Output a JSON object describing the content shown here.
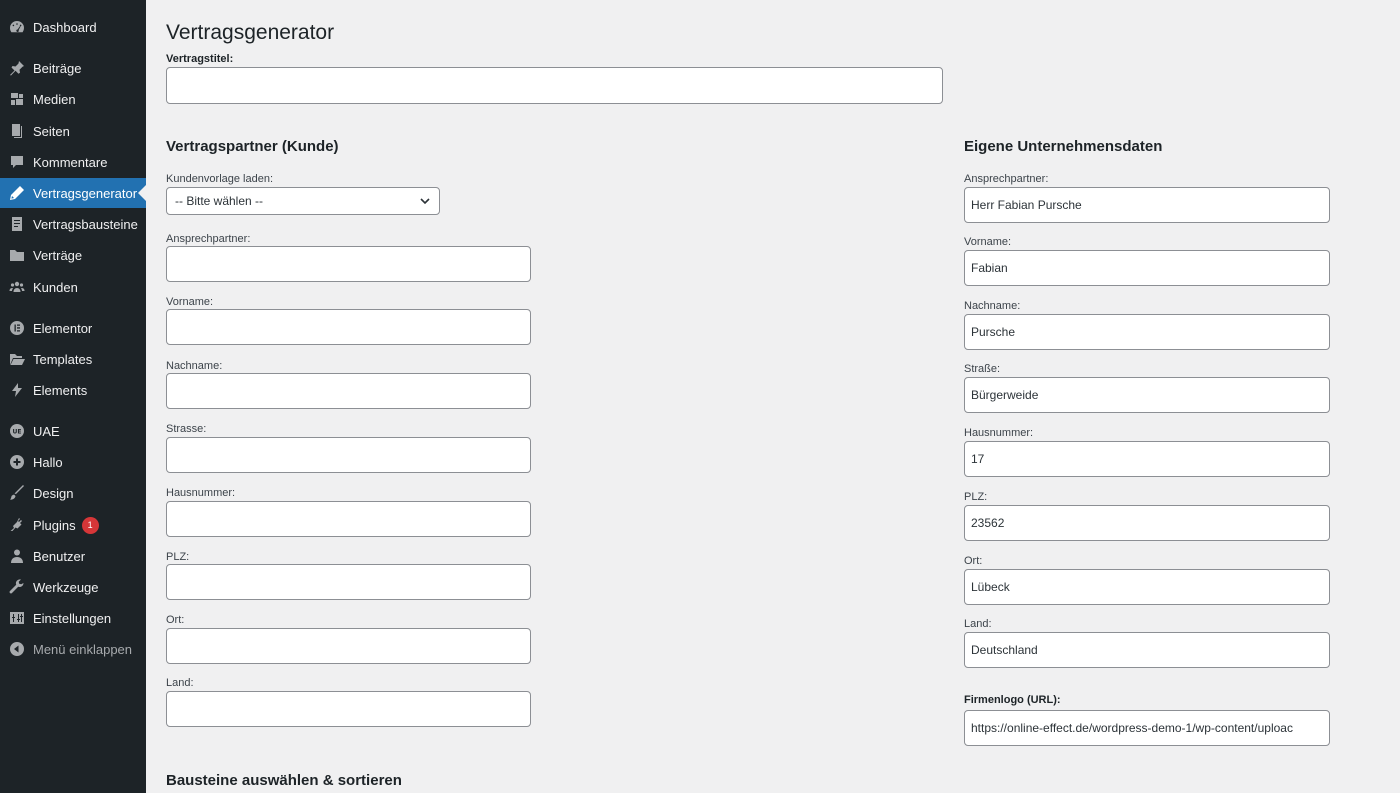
{
  "sidebar": {
    "items": [
      {
        "label": "Dashboard",
        "icon": "dashboard-icon"
      },
      {
        "label": "Beiträge",
        "icon": "pin-icon"
      },
      {
        "label": "Medien",
        "icon": "media-icon"
      },
      {
        "label": "Seiten",
        "icon": "page-icon"
      },
      {
        "label": "Kommentare",
        "icon": "comment-icon"
      },
      {
        "label": "Vertragsgenerator",
        "icon": "pencil-icon"
      },
      {
        "label": "Vertragsbausteine",
        "icon": "document-icon"
      },
      {
        "label": "Verträge",
        "icon": "folder-icon"
      },
      {
        "label": "Kunden",
        "icon": "groups-icon"
      },
      {
        "label": "Elementor",
        "icon": "elementor-icon"
      },
      {
        "label": "Templates",
        "icon": "folder-open-icon"
      },
      {
        "label": "Elements",
        "icon": "elements-icon"
      },
      {
        "label": "UAE",
        "icon": "uae-icon"
      },
      {
        "label": "Hallo",
        "icon": "plus-circle-icon"
      },
      {
        "label": "Design",
        "icon": "brush-icon"
      },
      {
        "label": "Plugins",
        "icon": "plug-icon",
        "badge": "1"
      },
      {
        "label": "Benutzer",
        "icon": "user-icon"
      },
      {
        "label": "Werkzeuge",
        "icon": "wrench-icon"
      },
      {
        "label": "Einstellungen",
        "icon": "settings-icon"
      },
      {
        "label": "Menü einklappen",
        "icon": "collapse-icon"
      }
    ]
  },
  "page": {
    "title": "Vertragsgenerator",
    "contract_title_label": "Vertragstitel:",
    "contract_title_value": ""
  },
  "customer": {
    "heading": "Vertragspartner (Kunde)",
    "template_label": "Kundenvorlage laden:",
    "template_selected": "-- Bitte wählen --",
    "fields": [
      {
        "label": "Ansprechpartner:",
        "value": ""
      },
      {
        "label": "Vorname:",
        "value": ""
      },
      {
        "label": "Nachname:",
        "value": ""
      },
      {
        "label": "Strasse:",
        "value": ""
      },
      {
        "label": "Hausnummer:",
        "value": ""
      },
      {
        "label": "PLZ:",
        "value": ""
      },
      {
        "label": "Ort:",
        "value": ""
      },
      {
        "label": "Land:",
        "value": ""
      }
    ]
  },
  "company": {
    "heading": "Eigene Unternehmensdaten",
    "fields": [
      {
        "label": "Ansprechpartner:",
        "value": "Herr Fabian Pursche"
      },
      {
        "label": "Vorname:",
        "value": "Fabian"
      },
      {
        "label": "Nachname:",
        "value": "Pursche"
      },
      {
        "label": "Straße:",
        "value": "Bürgerweide"
      },
      {
        "label": "Hausnummer:",
        "value": "17"
      },
      {
        "label": "PLZ:",
        "value": "23562"
      },
      {
        "label": "Ort:",
        "value": "Lübeck"
      },
      {
        "label": "Land:",
        "value": "Deutschland"
      }
    ],
    "logo_label": "Firmenlogo (URL):",
    "logo_value": "https://online-effect.de/wordpress-demo-1/wp-content/uploac"
  },
  "blocks": {
    "heading": "Bausteine auswählen & sortieren"
  },
  "colors": {
    "sidebar_bg": "#1d2327",
    "active_bg": "#2271b1",
    "page_bg": "#f0f0f1",
    "badge": "#d63638"
  }
}
